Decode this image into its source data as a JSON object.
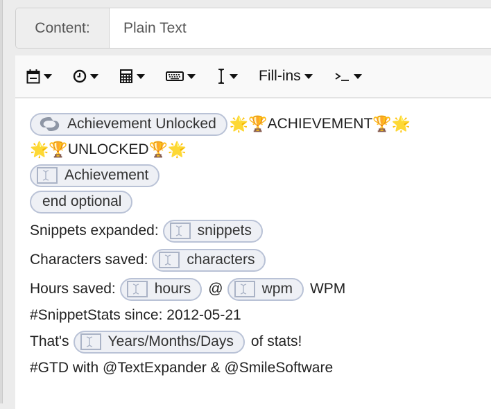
{
  "content_field": {
    "label": "Content:",
    "value": "Plain Text"
  },
  "toolbar": {
    "items": [
      {
        "icon": "calendar-icon"
      },
      {
        "icon": "clock-icon"
      },
      {
        "icon": "calculator-icon"
      },
      {
        "icon": "keyboard-icon"
      },
      {
        "icon": "text-cursor-icon"
      },
      {
        "label": "Fill-ins"
      },
      {
        "icon": "terminal-icon",
        "glyph": "›_"
      }
    ]
  },
  "snippet": {
    "line1": {
      "pill": "Achievement Unlocked",
      "emoji_star": "🌟",
      "emoji_trophy": "🏆",
      "text": "ACHIEVEMENT"
    },
    "line2": {
      "text": "UNLOCKED"
    },
    "line3": {
      "pill": "Achievement"
    },
    "line4": {
      "pill": "end optional"
    },
    "line5": {
      "label": "Snippets expanded:",
      "pill": "snippets"
    },
    "line6": {
      "label": "Characters saved:",
      "pill": "characters"
    },
    "line7": {
      "label": "Hours saved:",
      "pill1": "hours",
      "at": "@",
      "pill2": "wpm",
      "suffix": "WPM"
    },
    "line8": {
      "text": "#SnippetStats since: 2012-05-21"
    },
    "line9": {
      "prefix": "That's",
      "pill": "Years/Months/Days",
      "suffix": "of stats!"
    },
    "line10": {
      "text": "#GTD with @TextExpander & @SmileSoftware"
    }
  }
}
